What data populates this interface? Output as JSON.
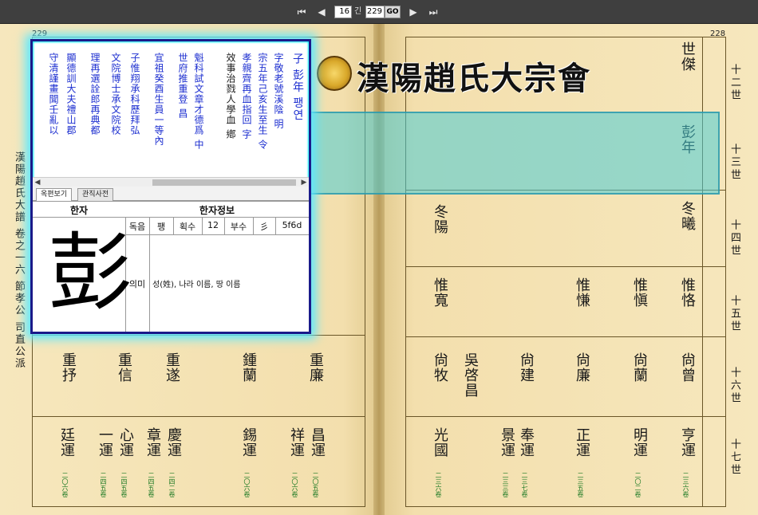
{
  "toolbar": {
    "first_glyph": "⏮",
    "prev_glyph": "◀",
    "next_glyph": "▶",
    "last_glyph": "⏭",
    "current_page": "16",
    "page_suffix": "긴",
    "total_pages": "229",
    "go_label": "GO"
  },
  "left_page": {
    "page_number": "229",
    "spine_title": "漢陽趙氏大譜 卷之一六 節孝公 司直公派",
    "gen_16": "十六世",
    "gen_17": "十七世",
    "names_16": [
      "重抒",
      "重信",
      "重遂",
      "鍾蘭",
      "重廉"
    ],
    "names_17": [
      "廷運",
      "一運",
      "心運",
      "章運",
      "慶運",
      "錫運",
      "祥運",
      "昌運"
    ],
    "green_notes": [
      "二〇六卷",
      "二四五卷",
      "二四五卷",
      "二四五卷",
      "二四二卷",
      "二〇六卷",
      "二〇六卷",
      "二〇五卷"
    ]
  },
  "right_page": {
    "page_number": "228",
    "gen_12": "十二世",
    "gen_13": "十三世",
    "gen_14": "十四世",
    "gen_15": "十五世",
    "gen_16": "十六世",
    "gen_17": "十七世",
    "name_12": "世傑",
    "name_13": "彭年",
    "names_14": [
      "冬曦",
      "冬陽"
    ],
    "names_15": [
      "惟恪",
      "惟愼",
      "惟慊",
      "惟寬"
    ],
    "names_16": [
      "尙曾",
      "尙蘭",
      "尙廉",
      "尙建",
      "吳啓昌",
      "尙牧"
    ],
    "names_17": [
      "亨運",
      "明運",
      "正運",
      "奉運",
      "景運",
      "光國"
    ],
    "green_notes": [
      "二三六卷",
      "二〇二卷",
      "二三五卷",
      "二三七卷",
      "二三三卷",
      "二三六卷"
    ]
  },
  "banner": {
    "title": "漢陽趙氏大宗會"
  },
  "popup": {
    "text_columns": [
      "子 彭年 팽연",
      "字敬老號溪陰 明",
      "宗五年己亥生至生 令",
      "孝親齊再血指回 字",
      "效事治戮人學血 鄕",
      "魁科試文章才德爲 中",
      "世府推重登 昌",
      "宜祖癸酉生員一等內",
      "守清謹畫聞壬亂以",
      "顯德訓大夫禮山郡",
      "理再選詮郎再典都",
      "文院博士承文院校",
      "子惟翔承科歷拜弘"
    ],
    "tabs": [
      "옥편보기",
      "관직사전"
    ],
    "header_char": "한자",
    "header_info": "한자정보",
    "big_char": "彭",
    "labels": {
      "reading": "독음",
      "strokes": "획수",
      "radical": "부수",
      "meaning": "의미"
    },
    "values": {
      "reading": "팽",
      "strokes": "12",
      "radical": "彡",
      "code": "5f6d",
      "meaning": "성(姓), 나라 이름, 땅 이름"
    }
  },
  "colors": {
    "page_bg": "#f4e3b4",
    "popup_border": "#1a1a8a",
    "popup_glow": "#5ce8ff",
    "highlight": "#48ccd6",
    "note_green": "#1d7a24",
    "text_blue": "#1d2fd0"
  }
}
